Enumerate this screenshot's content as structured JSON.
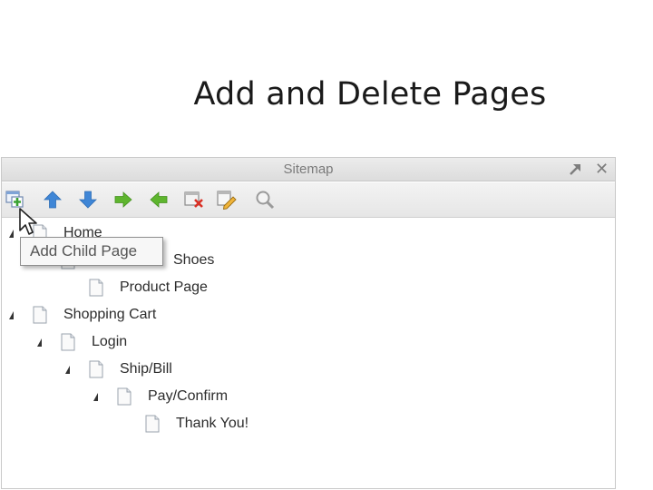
{
  "slide": {
    "title": "Add and Delete Pages"
  },
  "panel": {
    "title": "Sitemap",
    "close_symbol": "✕",
    "toolbar": [
      {
        "icon": "add-child-page-icon"
      },
      {
        "icon": "move-up-icon"
      },
      {
        "icon": "move-down-icon"
      },
      {
        "icon": "indent-icon"
      },
      {
        "icon": "outdent-icon"
      },
      {
        "icon": "delete-page-icon"
      },
      {
        "icon": "edit-page-icon"
      },
      {
        "icon": "search-icon"
      }
    ],
    "tooltip": "Add Child Page",
    "tree": [
      {
        "label": "Home",
        "level": 0,
        "expanded": true
      },
      {
        "label": "Shoes",
        "level": 1,
        "expanded": true
      },
      {
        "label": "Product Page",
        "level": 2,
        "expanded": false
      },
      {
        "label": "Shopping Cart",
        "level": 0,
        "expanded": true
      },
      {
        "label": "Login",
        "level": 1,
        "expanded": true
      },
      {
        "label": "Ship/Bill",
        "level": 2,
        "expanded": true
      },
      {
        "label": "Pay/Confirm",
        "level": 3,
        "expanded": true
      },
      {
        "label": "Thank You!",
        "level": 4,
        "expanded": false
      }
    ]
  },
  "colors": {
    "arrow_blue": "#3f86d6",
    "arrow_green": "#5eb52e",
    "delete_red": "#d93025"
  }
}
